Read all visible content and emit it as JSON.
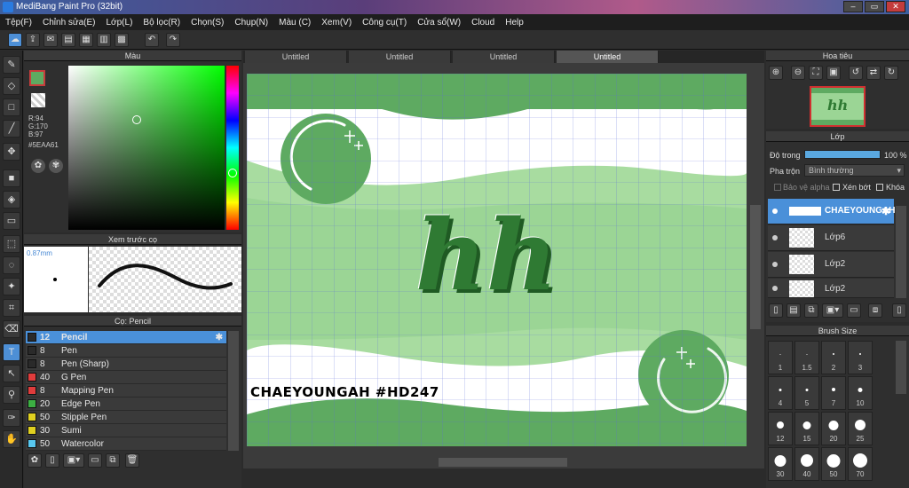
{
  "window": {
    "title": "MediBang Paint Pro (32bit)"
  },
  "menu": [
    "Tệp(F)",
    "Chỉnh sửa(E)",
    "Lớp(L)",
    "Bộ lọc(R)",
    "Chọn(S)",
    "Chụp(N)",
    "Màu (C)",
    "Xem(V)",
    "Công cụ(T)",
    "Cửa sổ(W)",
    "Cloud",
    "Help"
  ],
  "color_panel": {
    "title": "Màu",
    "r": "R:94",
    "g": "G:170",
    "b": "B:97",
    "hex": "#5EAA61",
    "current_color": "#5eaa61"
  },
  "brush_preview": {
    "title": "Xem trước cọ",
    "size": "0.87mm"
  },
  "brush_panel": {
    "title": "Cọ: Pencil",
    "items": [
      {
        "size": "12",
        "name": "Pencil",
        "color": "#2a2a2a"
      },
      {
        "size": "8",
        "name": "Pen",
        "color": "#2a2a2a"
      },
      {
        "size": "8",
        "name": "Pen (Sharp)",
        "color": "#2a2a2a"
      },
      {
        "size": "40",
        "name": "G Pen",
        "color": "#e03c3c"
      },
      {
        "size": "8",
        "name": "Mapping Pen",
        "color": "#e03c3c"
      },
      {
        "size": "20",
        "name": "Edge Pen",
        "color": "#3cb043"
      },
      {
        "size": "50",
        "name": "Stipple Pen",
        "color": "#e0d020"
      },
      {
        "size": "30",
        "name": "Sumi",
        "color": "#e0d020"
      },
      {
        "size": "50",
        "name": "Watercolor",
        "color": "#58c8f0"
      }
    ]
  },
  "tabs": [
    "Untitled",
    "Untitled",
    "Untitled",
    "Untitled"
  ],
  "canvas": {
    "hh": "hh",
    "caption": "CHAEYOUNGAH #HD247"
  },
  "navigator": {
    "title": "Hoa tiêu"
  },
  "layers": {
    "title": "Lớp",
    "opacity_label": "Độ trong",
    "opacity_value": "100 %",
    "blend_label": "Pha trộn",
    "blend_value": "Bình thường",
    "protect_alpha": "Bảo vệ alpha",
    "clipping": "Xén bớt",
    "lock": "Khóa",
    "items": [
      {
        "name": "CHAEYOUNGAH"
      },
      {
        "name": "Lớp6"
      },
      {
        "name": "Lớp2"
      },
      {
        "name": "Lớp2"
      }
    ]
  },
  "brush_size": {
    "title": "Brush Size",
    "sizes": [
      "1",
      "1.5",
      "2",
      "3",
      "4",
      "5",
      "7",
      "10",
      "12",
      "15",
      "20",
      "25",
      "30",
      "40",
      "50",
      "70"
    ]
  }
}
